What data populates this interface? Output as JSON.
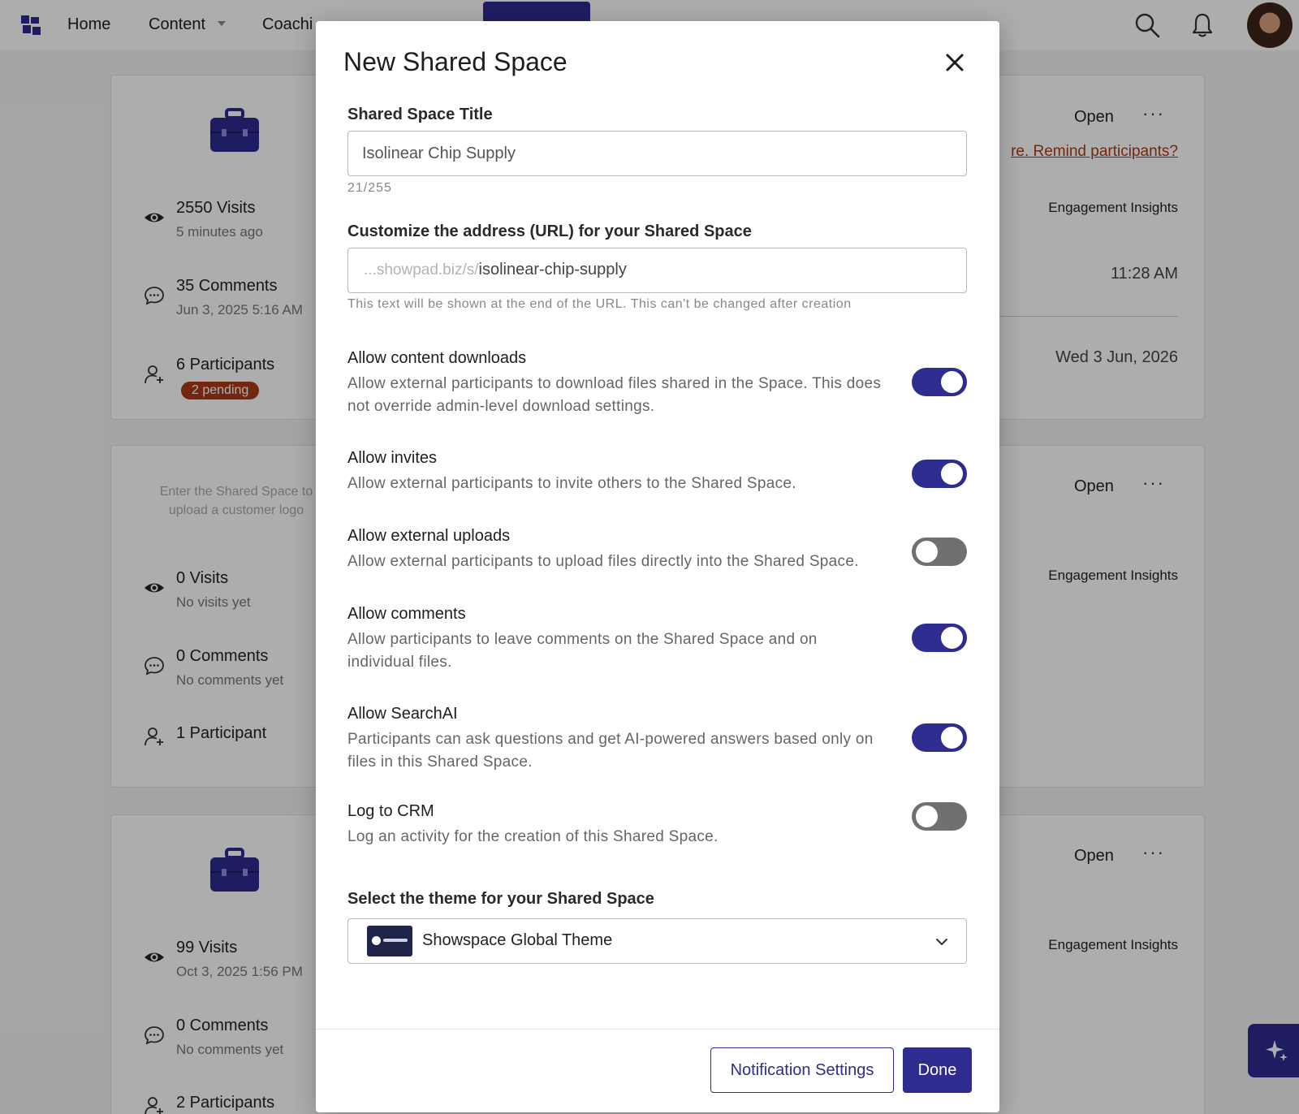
{
  "colors": {
    "accent": "#2f2c8f",
    "pending_badge": "#a83a16",
    "remind_link": "#a83a16"
  },
  "nav": {
    "logo_icon": "showpad-logo-icon",
    "items": [
      "Home",
      "Content",
      "Coachi"
    ],
    "content_caret_icon": "caret-down-icon",
    "create_label": "",
    "search_icon": "search-icon",
    "bell_icon": "bell-icon",
    "avatar_icon": "user-avatar"
  },
  "cards": [
    {
      "visits": "2550 Visits",
      "visits_sub": "5 minutes ago",
      "comments": "35 Comments",
      "comments_sub": "Jun 3, 2025 5:16 AM",
      "participants": "6 Participants",
      "pending": "2 pending",
      "open": "Open",
      "more": "···",
      "remind": "re. Remind participants?",
      "insights": "Engagement Insights",
      "time": "11:28 AM",
      "date": "Wed 3 Jun, 2026"
    },
    {
      "logo_placeholder": "Enter the Shared Space to upload a customer logo",
      "visits": "0 Visits",
      "visits_sub": "No visits yet",
      "comments": "0 Comments",
      "comments_sub": "No comments yet",
      "participants": "1 Participant",
      "open": "Open",
      "more": "···",
      "insights": "Engagement Insights"
    },
    {
      "visits": "99 Visits",
      "visits_sub": "Oct 3, 2025 1:56 PM",
      "comments": "0 Comments",
      "comments_sub": "No comments yet",
      "participants": "2 Participants",
      "open": "Open",
      "more": "···",
      "insights": "Engagement Insights"
    }
  ],
  "modal": {
    "title": "New Shared Space",
    "close_icon": "close-icon",
    "title_field": {
      "label": "Shared Space Title",
      "value": "Isolinear Chip Supply",
      "count": "21/255"
    },
    "url_field": {
      "label": "Customize the address (URL) for your Shared Space",
      "prefix": "...showpad.biz/s/",
      "slug": "isolinear-chip-supply",
      "help": "This text will be shown at the end of the URL. This can't be changed after creation"
    },
    "toggles": [
      {
        "title": "Allow content downloads",
        "desc": "Allow external participants to download files shared in the Space. This does not override admin-level download settings.",
        "on": true
      },
      {
        "title": "Allow invites",
        "desc": "Allow external participants to invite others to the Shared Space.",
        "on": true
      },
      {
        "title": "Allow external uploads",
        "desc": "Allow external participants to upload files directly into the Shared Space.",
        "on": false
      },
      {
        "title": "Allow comments",
        "desc": "Allow participants to leave comments on the Shared Space and on individual files.",
        "on": true
      },
      {
        "title": "Allow SearchAI",
        "desc": "Participants can ask questions and get AI-powered answers based only on files in this Shared Space.",
        "on": true
      },
      {
        "title": "Log to CRM",
        "desc": "Log an activity for the creation of this Shared Space.",
        "on": false
      }
    ],
    "theme": {
      "label": "Select the theme for your Shared Space",
      "selected": "Showspace Global Theme",
      "chevron_icon": "chevron-down-icon"
    },
    "buttons": {
      "notifications": "Notification Settings",
      "done": "Done"
    }
  },
  "fab": {
    "icon": "sparkle-icon"
  }
}
